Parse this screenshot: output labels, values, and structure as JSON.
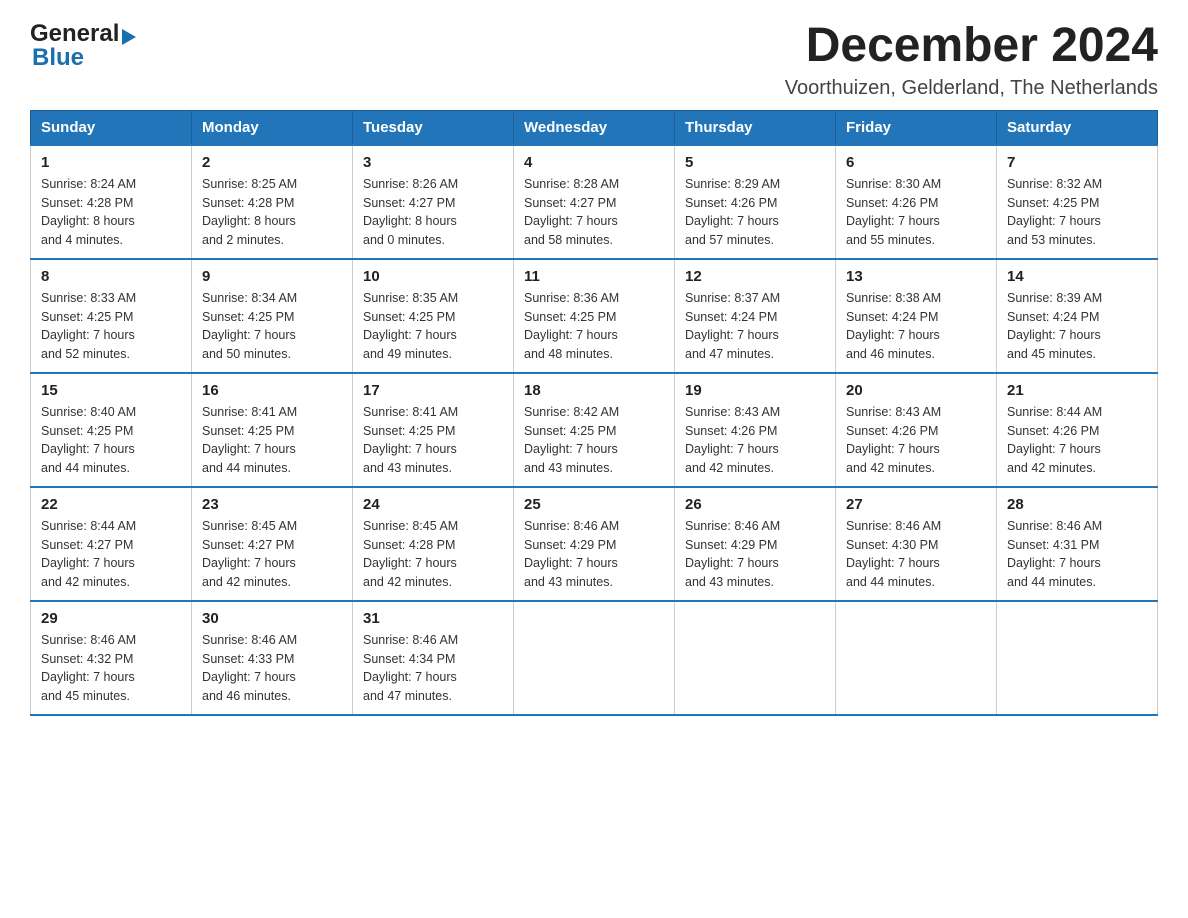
{
  "logo": {
    "line1": "General",
    "arrow": "▶",
    "line2": "Blue"
  },
  "title": "December 2024",
  "subtitle": "Voorthuizen, Gelderland, The Netherlands",
  "days_header": [
    "Sunday",
    "Monday",
    "Tuesday",
    "Wednesday",
    "Thursday",
    "Friday",
    "Saturday"
  ],
  "weeks": [
    [
      {
        "date": "1",
        "info": "Sunrise: 8:24 AM\nSunset: 4:28 PM\nDaylight: 8 hours\nand 4 minutes."
      },
      {
        "date": "2",
        "info": "Sunrise: 8:25 AM\nSunset: 4:28 PM\nDaylight: 8 hours\nand 2 minutes."
      },
      {
        "date": "3",
        "info": "Sunrise: 8:26 AM\nSunset: 4:27 PM\nDaylight: 8 hours\nand 0 minutes."
      },
      {
        "date": "4",
        "info": "Sunrise: 8:28 AM\nSunset: 4:27 PM\nDaylight: 7 hours\nand 58 minutes."
      },
      {
        "date": "5",
        "info": "Sunrise: 8:29 AM\nSunset: 4:26 PM\nDaylight: 7 hours\nand 57 minutes."
      },
      {
        "date": "6",
        "info": "Sunrise: 8:30 AM\nSunset: 4:26 PM\nDaylight: 7 hours\nand 55 minutes."
      },
      {
        "date": "7",
        "info": "Sunrise: 8:32 AM\nSunset: 4:25 PM\nDaylight: 7 hours\nand 53 minutes."
      }
    ],
    [
      {
        "date": "8",
        "info": "Sunrise: 8:33 AM\nSunset: 4:25 PM\nDaylight: 7 hours\nand 52 minutes."
      },
      {
        "date": "9",
        "info": "Sunrise: 8:34 AM\nSunset: 4:25 PM\nDaylight: 7 hours\nand 50 minutes."
      },
      {
        "date": "10",
        "info": "Sunrise: 8:35 AM\nSunset: 4:25 PM\nDaylight: 7 hours\nand 49 minutes."
      },
      {
        "date": "11",
        "info": "Sunrise: 8:36 AM\nSunset: 4:25 PM\nDaylight: 7 hours\nand 48 minutes."
      },
      {
        "date": "12",
        "info": "Sunrise: 8:37 AM\nSunset: 4:24 PM\nDaylight: 7 hours\nand 47 minutes."
      },
      {
        "date": "13",
        "info": "Sunrise: 8:38 AM\nSunset: 4:24 PM\nDaylight: 7 hours\nand 46 minutes."
      },
      {
        "date": "14",
        "info": "Sunrise: 8:39 AM\nSunset: 4:24 PM\nDaylight: 7 hours\nand 45 minutes."
      }
    ],
    [
      {
        "date": "15",
        "info": "Sunrise: 8:40 AM\nSunset: 4:25 PM\nDaylight: 7 hours\nand 44 minutes."
      },
      {
        "date": "16",
        "info": "Sunrise: 8:41 AM\nSunset: 4:25 PM\nDaylight: 7 hours\nand 44 minutes."
      },
      {
        "date": "17",
        "info": "Sunrise: 8:41 AM\nSunset: 4:25 PM\nDaylight: 7 hours\nand 43 minutes."
      },
      {
        "date": "18",
        "info": "Sunrise: 8:42 AM\nSunset: 4:25 PM\nDaylight: 7 hours\nand 43 minutes."
      },
      {
        "date": "19",
        "info": "Sunrise: 8:43 AM\nSunset: 4:26 PM\nDaylight: 7 hours\nand 42 minutes."
      },
      {
        "date": "20",
        "info": "Sunrise: 8:43 AM\nSunset: 4:26 PM\nDaylight: 7 hours\nand 42 minutes."
      },
      {
        "date": "21",
        "info": "Sunrise: 8:44 AM\nSunset: 4:26 PM\nDaylight: 7 hours\nand 42 minutes."
      }
    ],
    [
      {
        "date": "22",
        "info": "Sunrise: 8:44 AM\nSunset: 4:27 PM\nDaylight: 7 hours\nand 42 minutes."
      },
      {
        "date": "23",
        "info": "Sunrise: 8:45 AM\nSunset: 4:27 PM\nDaylight: 7 hours\nand 42 minutes."
      },
      {
        "date": "24",
        "info": "Sunrise: 8:45 AM\nSunset: 4:28 PM\nDaylight: 7 hours\nand 42 minutes."
      },
      {
        "date": "25",
        "info": "Sunrise: 8:46 AM\nSunset: 4:29 PM\nDaylight: 7 hours\nand 43 minutes."
      },
      {
        "date": "26",
        "info": "Sunrise: 8:46 AM\nSunset: 4:29 PM\nDaylight: 7 hours\nand 43 minutes."
      },
      {
        "date": "27",
        "info": "Sunrise: 8:46 AM\nSunset: 4:30 PM\nDaylight: 7 hours\nand 44 minutes."
      },
      {
        "date": "28",
        "info": "Sunrise: 8:46 AM\nSunset: 4:31 PM\nDaylight: 7 hours\nand 44 minutes."
      }
    ],
    [
      {
        "date": "29",
        "info": "Sunrise: 8:46 AM\nSunset: 4:32 PM\nDaylight: 7 hours\nand 45 minutes."
      },
      {
        "date": "30",
        "info": "Sunrise: 8:46 AM\nSunset: 4:33 PM\nDaylight: 7 hours\nand 46 minutes."
      },
      {
        "date": "31",
        "info": "Sunrise: 8:46 AM\nSunset: 4:34 PM\nDaylight: 7 hours\nand 47 minutes."
      },
      null,
      null,
      null,
      null
    ]
  ]
}
